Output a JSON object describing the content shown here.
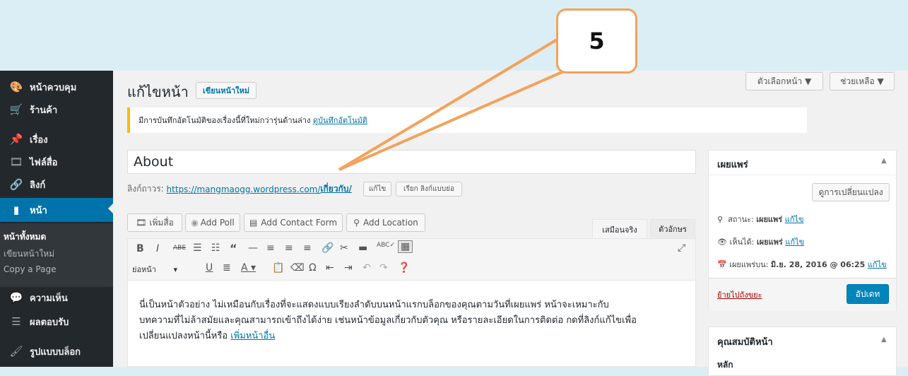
{
  "annotation": {
    "number": "5"
  },
  "sidebar": {
    "items": [
      {
        "label": "หน้าควบคุม",
        "icon": "dashboard-icon",
        "glyph": "🎨"
      },
      {
        "label": "ร้านค้า",
        "icon": "cart-icon",
        "glyph": "🛒"
      },
      {
        "label": "เรื่อง",
        "icon": "pin-icon",
        "glyph": "📌"
      },
      {
        "label": "ไฟล์สื่อ",
        "icon": "media-icon",
        "glyph": "🎞"
      },
      {
        "label": "ลิงก์",
        "icon": "link-icon",
        "glyph": "🔗"
      },
      {
        "label": "หน้า",
        "icon": "page-icon",
        "glyph": "▮"
      }
    ],
    "subitems": [
      "หน้าทั้งหมด",
      "เขียนหน้าใหม่",
      "Copy a Page"
    ],
    "items2": [
      {
        "label": "ความเห็น",
        "icon": "comment-icon",
        "glyph": "💬"
      },
      {
        "label": "ผลตอบรับ",
        "icon": "feedback-icon",
        "glyph": "☰"
      },
      {
        "label": "รูปแบบบล็อก",
        "icon": "appearance-icon",
        "glyph": "🖌"
      }
    ]
  },
  "header": {
    "screen_options": "ตัวเลือกหน้า ▼",
    "help": "ช่วยเหลือ ▼",
    "title": "แก้ไขหน้า",
    "add_new": "เขียนหน้าใหม่"
  },
  "notice": {
    "text": "มีการบันทึกอัตโนมัติของเรื่องนี้ที่ใหม่กว่ารุ่นด้านล่าง",
    "link": "ดูบันทึกอัตโนมัติ"
  },
  "editor": {
    "title_value": "About",
    "permalink_label": "ลิงก์ถาวร:",
    "permalink_url": "https://mangmaogg.wordpress.com/",
    "permalink_slug": "เกี่ยวกับ/",
    "edit_btn": "แก้ไข",
    "shortlink_btn": "เรียก ลิงก์แบบย่อ",
    "media_buttons": [
      "เพิ่มสื่อ",
      "Add Poll",
      "Add Contact Form",
      "Add Location"
    ],
    "tabs": [
      "เสมือนจริง",
      "ตัวอักษร"
    ],
    "format_select": "ย่อหน้า",
    "content_text": "นี่เป็นหน้าตัวอย่าง ไม่เหมือนกับเรื่องที่จะแสดงแบบเรียงลำดับบนหน้าแรกบล็อกของคุณตามวันที่เผยแพร่ หน้าจะเหมาะกับ",
    "content_text2": "บทความที่ไม่ล้าสมัยและคุณสามารถเข้าถึงได้ง่าย เช่นหน้าข้อมูลเกี่ยวกับตัวคุณ หรือรายละเอียดในการติดต่อ กดที่ลิงก์แก้ไขเพื่อ",
    "content_text3": "เปลี่ยนแปลงหน้านี้หรือ",
    "content_link": "เพิ่มหน้าอื่น"
  },
  "publish": {
    "title": "เผยแพร่",
    "preview_changes": "ดูการเปลี่ยนแปลง",
    "status_label": "สถานะ:",
    "status_value": "เผยแพร่",
    "visibility_label": "เห็นได้:",
    "visibility_value": "เผยแพร่",
    "date_label": "เผยแพร่บน:",
    "date_value": "มิ.ย. 28, 2016 @ 06:25",
    "edit": "แก้ไข",
    "trash": "ย้ายไปถังขยะ",
    "update": "อัปเดท"
  },
  "attributes": {
    "title": "คุณสมบัติหน้า",
    "parent_label": "หลัก"
  },
  "colors": {
    "accent": "#0073aa",
    "arrow": "#f4a25b",
    "notice": "#ffb900"
  }
}
